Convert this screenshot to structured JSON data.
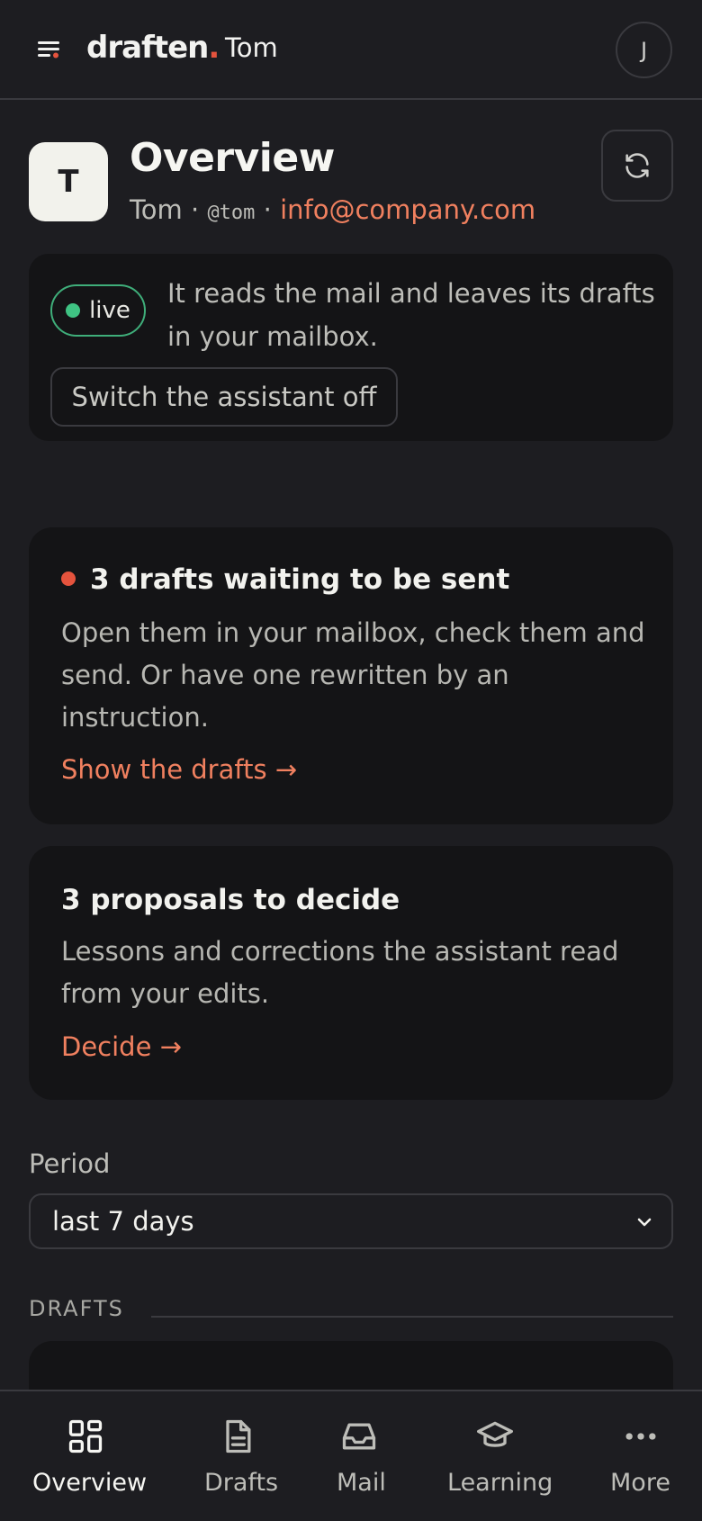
{
  "app": {
    "logo_text": "draften",
    "logo_dot": ".",
    "current_user": "Tom",
    "account_initial": "J"
  },
  "header": {
    "avatar_initial": "T",
    "title": "Overview",
    "name": "Tom",
    "separator": "·",
    "handle": "@tom",
    "email": "info@company.com"
  },
  "status": {
    "badge": "live",
    "description": "It reads the mail and leaves its drafts in your mailbox.",
    "switch_label": "Switch the assistant off"
  },
  "drafts_card": {
    "title": "3 drafts waiting to be sent",
    "body": "Open them in your mailbox, check them and send. Or have one rewritten by an instruction.",
    "link": "Show the drafts →"
  },
  "proposals_card": {
    "title": "3 proposals to decide",
    "body": "Lessons and corrections the assistant read from your edits.",
    "link": "Decide →"
  },
  "period": {
    "label": "Period",
    "value": "last 7 days"
  },
  "section": {
    "label": "DRAFTS"
  },
  "nav": {
    "items": [
      {
        "label": "Overview",
        "icon": "grid-icon"
      },
      {
        "label": "Drafts",
        "icon": "document-icon"
      },
      {
        "label": "Mail",
        "icon": "inbox-icon"
      },
      {
        "label": "Learning",
        "icon": "graduation-cap-icon"
      },
      {
        "label": "More",
        "icon": "more-dots-icon"
      }
    ],
    "active": "Overview"
  },
  "colors": {
    "accent": "#f0805f",
    "live": "#3fc383",
    "alert": "#e5533d",
    "background": "#1d1d21",
    "card": "#141416"
  }
}
